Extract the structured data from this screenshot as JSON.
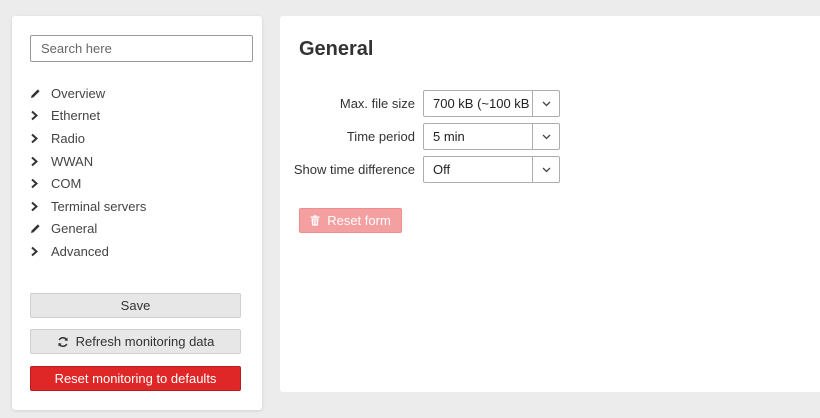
{
  "sidebar": {
    "search_placeholder": "Search here",
    "items": [
      {
        "label": "Overview",
        "icon": "pencil-icon"
      },
      {
        "label": "Ethernet",
        "icon": "chevron-right-icon"
      },
      {
        "label": "Radio",
        "icon": "chevron-right-icon"
      },
      {
        "label": "WWAN",
        "icon": "chevron-right-icon"
      },
      {
        "label": "COM",
        "icon": "chevron-right-icon"
      },
      {
        "label": "Terminal servers",
        "icon": "chevron-right-icon"
      },
      {
        "label": "General",
        "icon": "pencil-icon"
      },
      {
        "label": "Advanced",
        "icon": "chevron-right-icon"
      }
    ],
    "save_label": "Save",
    "refresh_label": "Refresh monitoring data",
    "reset_defaults_label": "Reset monitoring to defaults"
  },
  "main": {
    "title": "General",
    "fields": [
      {
        "label": "Max. file size",
        "value": "700 kB (~100 kB"
      },
      {
        "label": "Time period",
        "value": "5 min"
      },
      {
        "label": "Show time difference",
        "value": "Off"
      }
    ],
    "reset_form_label": "Reset form"
  },
  "colors": {
    "danger": "#e02727",
    "danger_disabled": "#f4a0a0",
    "button_grey": "#e7e7e7"
  }
}
